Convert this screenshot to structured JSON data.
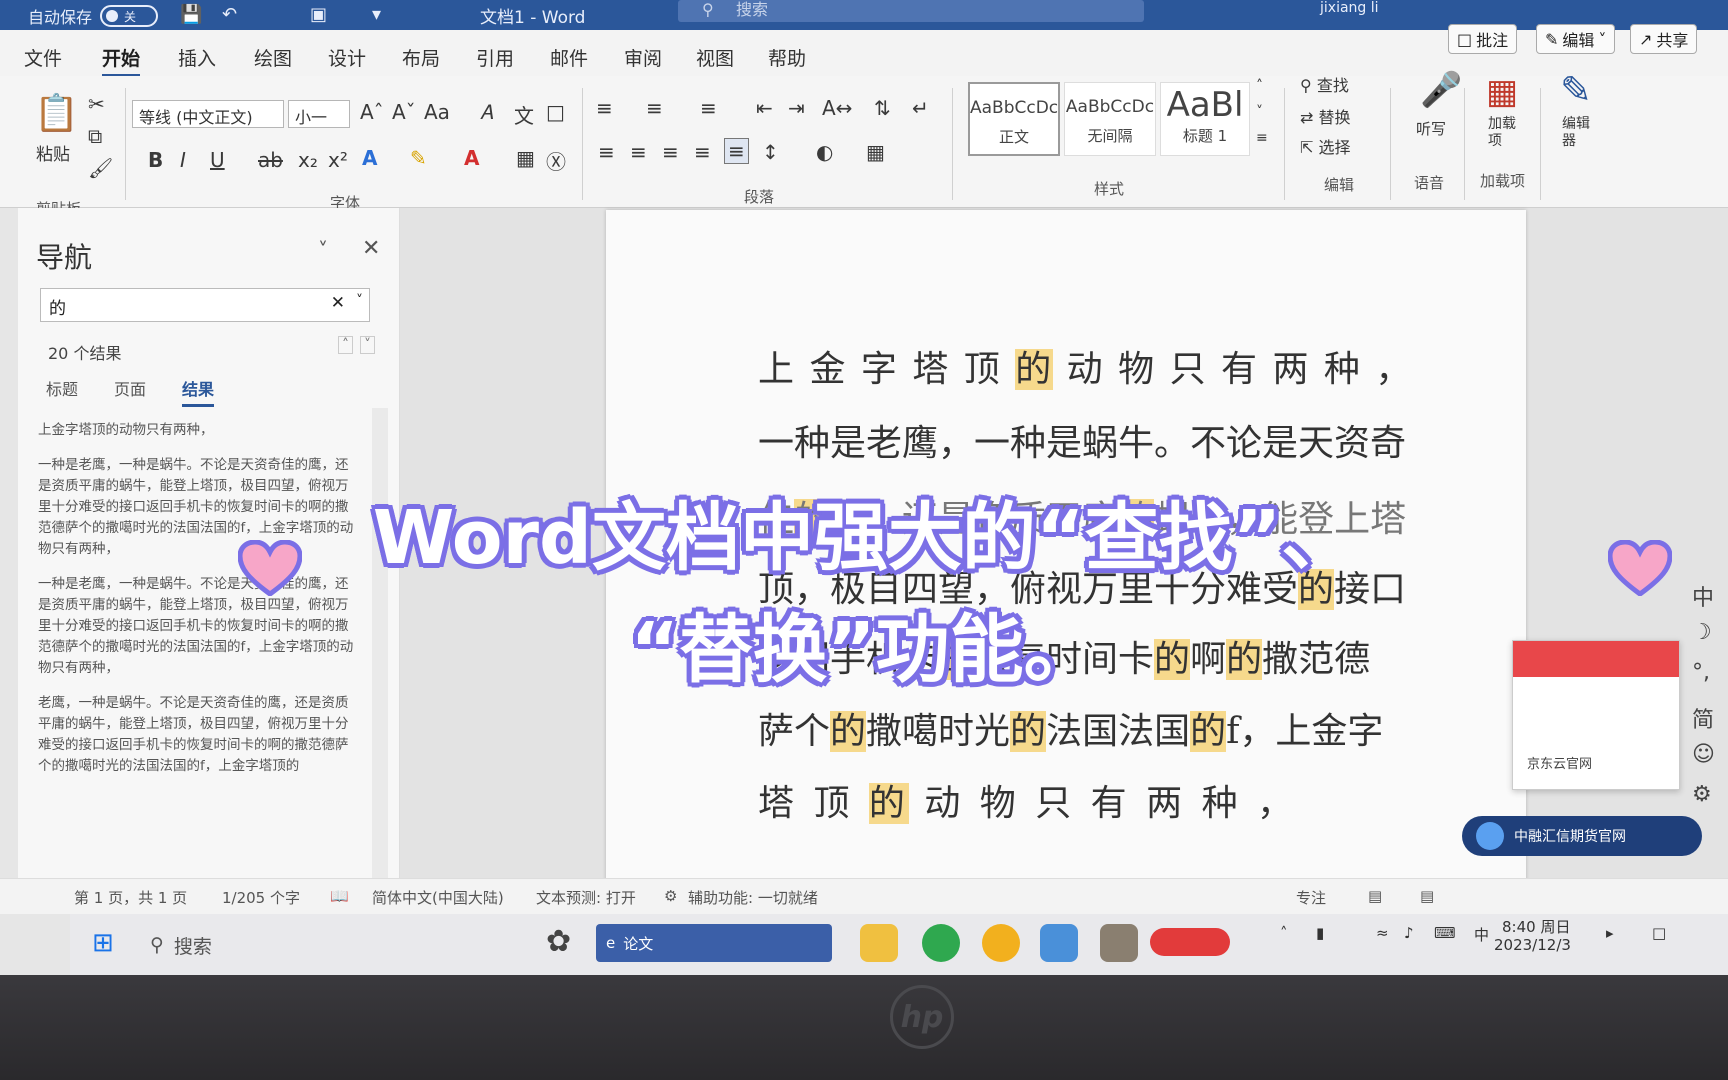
{
  "titlebar": {
    "autosave_label": "自动保存",
    "autosave_state": "关",
    "doc_title": "文档1 - Word",
    "search_placeholder": "搜索",
    "user": "jixiang li"
  },
  "ribbon_tabs": [
    "文件",
    "开始",
    "插入",
    "绘图",
    "设计",
    "布局",
    "引用",
    "邮件",
    "审阅",
    "视图",
    "帮助"
  ],
  "active_tab": "开始",
  "top_buttons": {
    "comment": "批注",
    "edit": "编辑",
    "share": "共享"
  },
  "ribbon": {
    "clipboard": {
      "paste": "粘贴",
      "label": "剪贴板"
    },
    "font": {
      "font_name": "等线 (中文正文)",
      "font_size": "小一",
      "label": "字体"
    },
    "paragraph": {
      "label": "段落"
    },
    "styles": {
      "label": "样式",
      "items": [
        {
          "preview": "AaBbCcDc",
          "name": "正文"
        },
        {
          "preview": "AaBbCcDc",
          "name": "无间隔"
        },
        {
          "preview": "AaBl",
          "name": "标题 1"
        }
      ]
    },
    "editing": {
      "find": "查找",
      "replace": "替换",
      "select": "选择",
      "label": "编辑"
    },
    "voice": {
      "dictate": "听写",
      "label": "语音"
    },
    "addins": {
      "addins": "加载项",
      "label": "加载项"
    },
    "editor": {
      "label": "编辑器"
    }
  },
  "nav_pane": {
    "title": "导航",
    "search_value": "的",
    "result_count": "20 个结果",
    "tabs": [
      "标题",
      "页面",
      "结果"
    ],
    "active_tab": "结果",
    "results": [
      "上金字塔顶的动物只有两种，",
      "一种是老鹰，一种是蜗牛。不论是天资奇佳的鹰，还是资质平庸的蜗牛，能登上塔顶，极目四望，俯视万里十分难受的接口返回手机卡的恢复时间卡的啊的撒范德萨个的撒噶时光的法国法国的f，上金字塔顶的动物只有两种，",
      "一种是老鹰，一种是蜗牛。不论是天资奇佳的鹰，还是资质平庸的蜗牛，能登上塔顶，极目四望，俯视万里十分难受的接口返回手机卡的恢复时间卡的啊的撒范德萨个的撒噶时光的法国法国的f，上金字塔顶的动物只有两种，",
      "老鹰，一种是蜗牛。不论是天资奇佳的鹰，还是资质平庸的蜗牛，能登上塔顶，极目四望，俯视万里十分难受的接口返回手机卡的恢复时间卡的啊的撒范德萨个的撒噶时光的法国法国的f，上金字塔顶的"
    ]
  },
  "document_lines": [
    "上 金 字 塔 顶 的 动 物 只 有 两 种 ，",
    "一种是老鹰，一种是蜗牛。不论是天资奇",
    "佳的鹰，还是资质平庸的蜗牛，能登上塔",
    "顶，极目四望，俯视万里十分难受的接口",
    "返回手机卡的恢复时间卡的啊的撒范德",
    "萨个的撒噶时光的法国法国的f，上金字",
    "塔 顶 的 动 物 只 有 两 种 ，"
  ],
  "statusbar": {
    "page": "第 1 页，共 1 页",
    "words": "1/205 个字",
    "language": "简体中文(中国大陆)",
    "prediction": "文本预测: 打开",
    "accessibility": "辅助功能: 一切就绪",
    "focus": "专注"
  },
  "taskbar": {
    "search": "搜索",
    "app_label": "论文",
    "time": "8:40 周日",
    "date": "2023/12/3",
    "ime": "中"
  },
  "popups": {
    "jd_card": "京东云官网",
    "notification": "中融汇信期货官网"
  },
  "ime_bar": [
    "中",
    "简"
  ],
  "overlay": {
    "line1": "Word文档中强大的“查找”、",
    "line2": "“替换”功能。"
  },
  "colors": {
    "title_bar": "#2b579a",
    "highlight": "#f6d98c",
    "overlay_outline": "#7b6fe6"
  }
}
